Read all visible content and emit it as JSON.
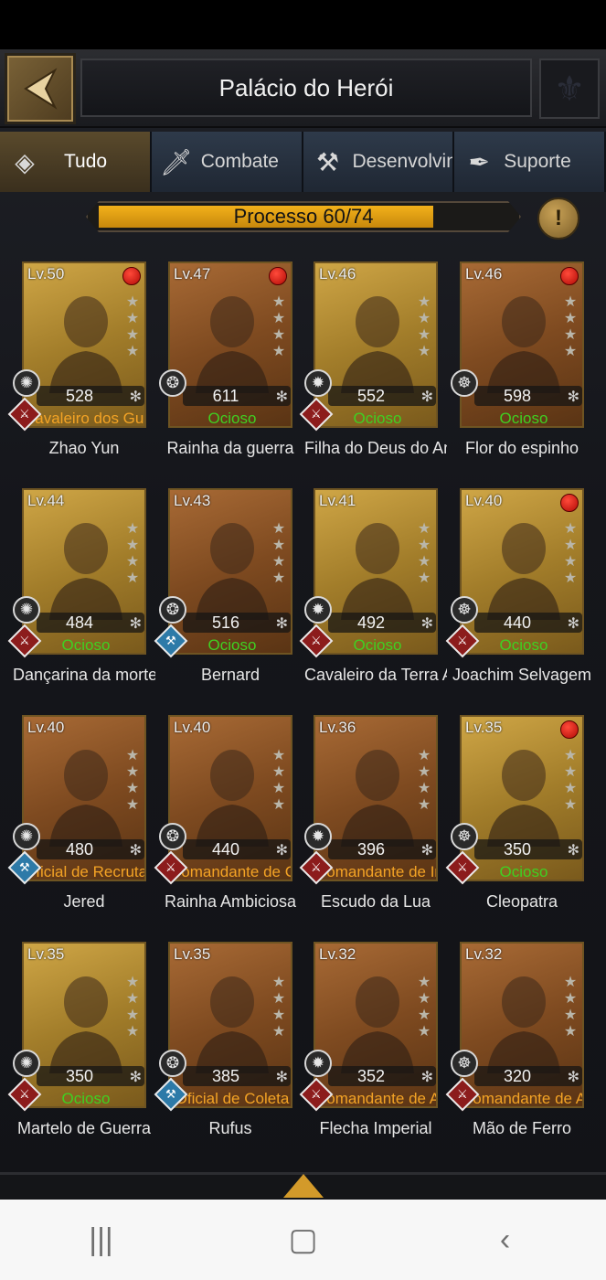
{
  "header": {
    "title": "Palácio do Herói"
  },
  "tabs": [
    {
      "label": "Tudo",
      "icon": "diamond-icon",
      "active": true
    },
    {
      "label": "Combate",
      "icon": "sword-icon",
      "active": false
    },
    {
      "label": "Desenvolvimento",
      "icon": "hammer-icon",
      "active": false
    },
    {
      "label": "Suporte",
      "icon": "feather-icon",
      "active": false
    }
  ],
  "progress": {
    "label": "Processo 60/74",
    "current": 60,
    "total": 74
  },
  "heroes": [
    {
      "level": "Lv.50",
      "power": "528",
      "status": "Cavaleiro dos Guardiões",
      "name": "Zhao Yun",
      "card": "gold",
      "dot": true,
      "status_type": "busy",
      "role": "red"
    },
    {
      "level": "Lv.47",
      "power": "611",
      "status": "Ocioso",
      "name": "Rainha da guerra",
      "card": "bronze",
      "dot": true,
      "status_type": "idle",
      "role": "none"
    },
    {
      "level": "Lv.46",
      "power": "552",
      "status": "Ocioso",
      "name": "Filha do Deus do Amor",
      "card": "gold",
      "dot": false,
      "status_type": "idle",
      "role": "red"
    },
    {
      "level": "Lv.46",
      "power": "598",
      "status": "Ocioso",
      "name": "Flor do espinho",
      "card": "bronze",
      "dot": true,
      "status_type": "idle",
      "role": "none"
    },
    {
      "level": "Lv.44",
      "power": "484",
      "status": "Ocioso",
      "name": "Dançarina da morte",
      "card": "gold",
      "dot": false,
      "status_type": "idle",
      "role": "red"
    },
    {
      "level": "Lv.43",
      "power": "516",
      "status": "Ocioso",
      "name": "Bernard",
      "card": "bronze",
      "dot": false,
      "status_type": "idle",
      "role": "blue"
    },
    {
      "level": "Lv.41",
      "power": "492",
      "status": "Ocioso",
      "name": "Cavaleiro da Terra Abandonada",
      "card": "gold",
      "dot": false,
      "status_type": "idle",
      "role": "red"
    },
    {
      "level": "Lv.40",
      "power": "440",
      "status": "Ocioso",
      "name": "Joachim Selvagem",
      "card": "gold",
      "dot": true,
      "status_type": "idle",
      "role": "red"
    },
    {
      "level": "Lv.40",
      "power": "480",
      "status": "Oficial de Recrutamento",
      "name": "Jered",
      "card": "bronze",
      "dot": false,
      "status_type": "busy",
      "role": "blue"
    },
    {
      "level": "Lv.40",
      "power": "440",
      "status": "Comandante de Cavalaria",
      "name": "Rainha Ambiciosa",
      "card": "bronze",
      "dot": false,
      "status_type": "busy",
      "role": "red"
    },
    {
      "level": "Lv.36",
      "power": "396",
      "status": "Comandante de Infantaria",
      "name": "Escudo da Lua",
      "card": "bronze",
      "dot": false,
      "status_type": "busy",
      "role": "red"
    },
    {
      "level": "Lv.35",
      "power": "350",
      "status": "Ocioso",
      "name": "Cleopatra",
      "card": "gold",
      "dot": true,
      "status_type": "idle",
      "role": "red"
    },
    {
      "level": "Lv.35",
      "power": "350",
      "status": "Ocioso",
      "name": "Martelo de Guerra",
      "card": "gold",
      "dot": false,
      "status_type": "idle",
      "role": "red"
    },
    {
      "level": "Lv.35",
      "power": "385",
      "status": "Oficial de Coleta",
      "name": "Rufus",
      "card": "bronze",
      "dot": false,
      "status_type": "busy",
      "role": "blue"
    },
    {
      "level": "Lv.32",
      "power": "352",
      "status": "Comandante de Arqueiros",
      "name": "Flecha Imperial",
      "card": "bronze",
      "dot": false,
      "status_type": "busy",
      "role": "red"
    },
    {
      "level": "Lv.32",
      "power": "320",
      "status": "Comandante de Arma de Cerco",
      "name": "Mão de Ferro",
      "card": "bronze",
      "dot": false,
      "status_type": "busy",
      "role": "red"
    }
  ],
  "navbar": {
    "recent_icon": "recent-apps-icon",
    "home_icon": "home-icon",
    "back_icon": "back-icon"
  },
  "colors": {
    "idle": "#3fd022",
    "busy": "#f3a325",
    "progress": "#e9a516",
    "red_dot": "#d8180e"
  }
}
